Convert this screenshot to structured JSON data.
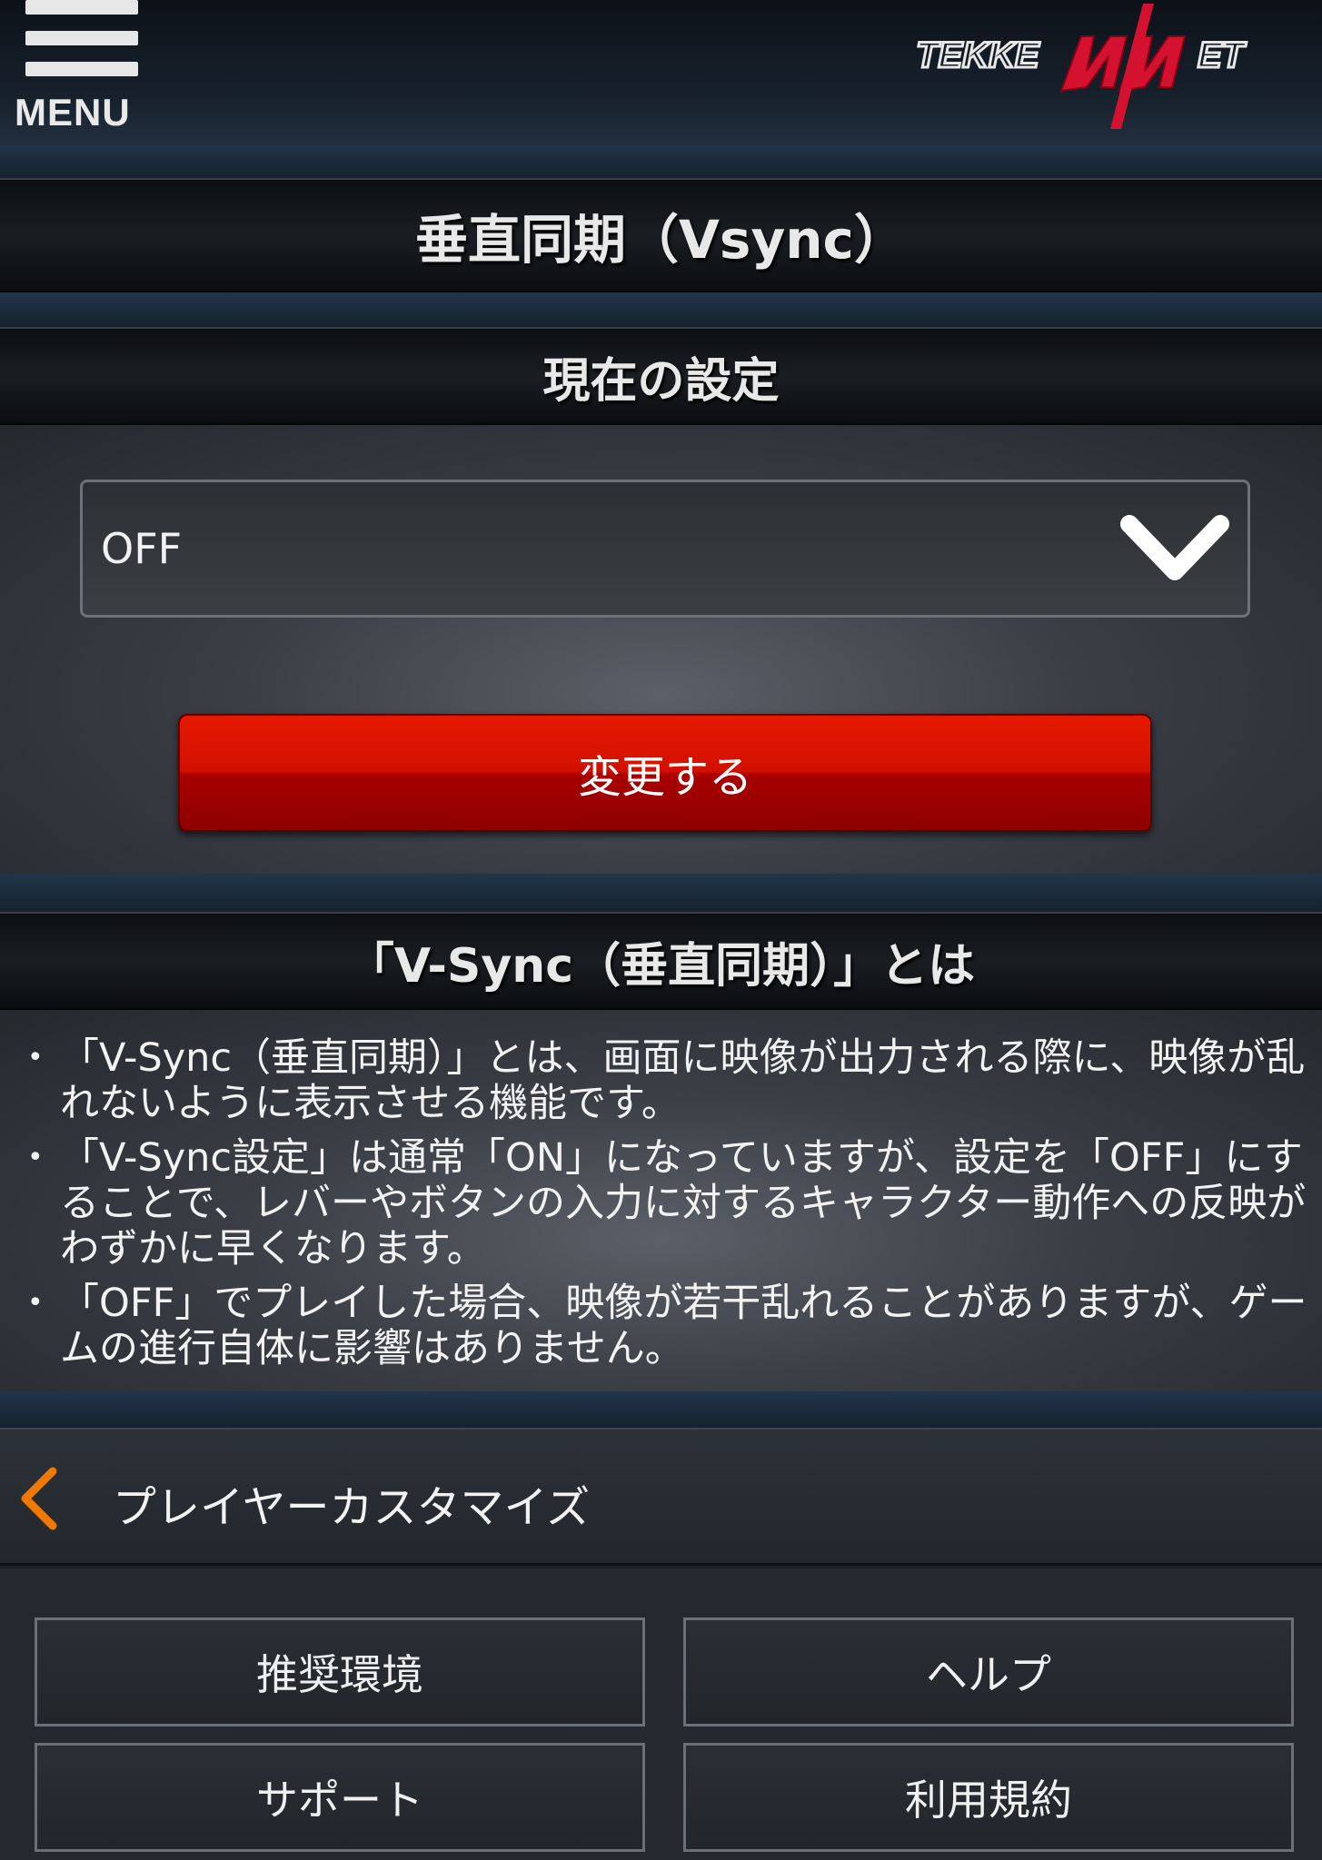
{
  "header": {
    "menu_label": "MENU",
    "logo_text": "TEKKEN NET"
  },
  "page": {
    "title": "垂直同期（Vsync）"
  },
  "current_setting": {
    "header": "現在の設定",
    "select_value": "OFF",
    "change_button": "変更する"
  },
  "about": {
    "header": "「V-Sync（垂直同期）」とは",
    "items": [
      "「V-Sync（垂直同期）」とは、画面に映像が出力される際に、映像が乱れないように表示させる機能です。",
      "「V-Sync設定」は通常「ON」になっていますが、設定を「OFF」にすることで、レバーやボタンの入力に対するキャラクター動作への反映がわずかに早くなります。",
      "「OFF」でプレイした場合、映像が若干乱れることがありますが、ゲームの進行自体に影響はありません。"
    ]
  },
  "nav": {
    "back_label": "プレイヤーカスタマイズ"
  },
  "footer": {
    "recommended": "推奨環境",
    "help": "ヘルプ",
    "support": "サポート",
    "terms": "利用規約"
  },
  "colors": {
    "accent_red": "#d31000",
    "back_arrow_orange": "#f07800"
  },
  "icons": {
    "menu": "hamburger-icon",
    "select": "chevron-down-icon",
    "back": "chevron-left-icon"
  }
}
